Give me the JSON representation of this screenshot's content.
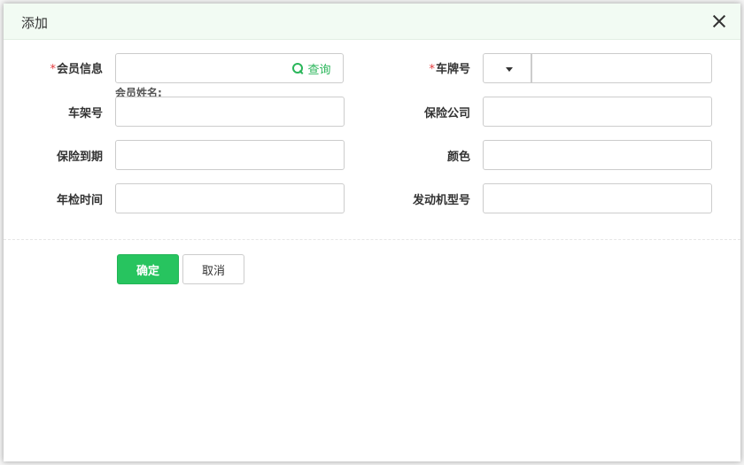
{
  "dialog": {
    "title": "添加"
  },
  "form": {
    "member_info": {
      "label": "会员信息",
      "required": "*",
      "value": "",
      "search_label": "查询"
    },
    "member_name": {
      "label": "会员姓名:"
    },
    "plate_no": {
      "label": "车牌号",
      "required": "*",
      "prefix_value": "",
      "value": ""
    },
    "vin": {
      "label": "车架号",
      "value": ""
    },
    "insurer": {
      "label": "保险公司",
      "value": ""
    },
    "insurance_expiry": {
      "label": "保险到期",
      "value": ""
    },
    "color": {
      "label": "颜色",
      "value": ""
    },
    "inspection_time": {
      "label": "年检时间",
      "value": ""
    },
    "engine_model": {
      "label": "发动机型号",
      "value": ""
    }
  },
  "footer": {
    "confirm_label": "确定",
    "cancel_label": "取消"
  },
  "colors": {
    "accent": "#27c45f",
    "header_bg": "#f2fbf3",
    "required": "#e4393c"
  }
}
